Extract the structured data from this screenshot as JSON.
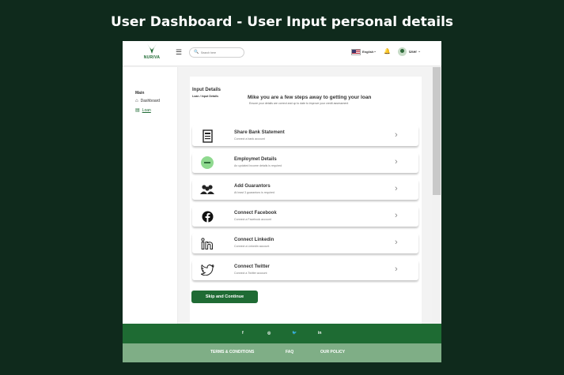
{
  "banner": {
    "title": "User Dashboard - User Input personal details"
  },
  "header": {
    "logo_text": "NURIVA",
    "search_placeholder": "Search here",
    "language": "English",
    "user_label": "User"
  },
  "sidebar": {
    "section": "Main",
    "items": [
      {
        "label": "Dashboard",
        "icon": "home-icon"
      },
      {
        "label": "Loan",
        "icon": "document-icon"
      }
    ]
  },
  "content": {
    "title": "Input Details",
    "breadcrumb": "Loan / Input Details",
    "headline": "Mike you are a few steps away to getting your loan",
    "subline": "Ensure your details are correct and up to date to improve your credit assessment",
    "rows": [
      {
        "title": "Share Bank Statement",
        "subtitle": "Connect a bank account",
        "icon": "bank-statement-icon"
      },
      {
        "title": "Employmet Details",
        "subtitle": "An updated income details is required",
        "icon": "employment-icon"
      },
      {
        "title": "Add Guarantors",
        "subtitle": "At least 3 guarantors is required",
        "icon": "guarantors-icon"
      },
      {
        "title": "Connect Facebook",
        "subtitle": "Connect a Facebook account",
        "icon": "facebook-icon"
      },
      {
        "title": "Connect Linkedin",
        "subtitle": "Connect a Linkedin account",
        "icon": "linkedin-icon"
      },
      {
        "title": "Connect Twitter",
        "subtitle": "Connect a Twitter account",
        "icon": "twitter-icon"
      }
    ],
    "skip_label": "Skip and Continue"
  },
  "footer": {
    "social": [
      "f",
      "◎",
      "🐦",
      "in"
    ],
    "links": [
      "TERMS & CONDITIONS",
      "FAQ",
      "OUR POLICY"
    ]
  },
  "colors": {
    "brand": "#1f6b34",
    "footer_light": "#7fae86",
    "background": "#0f2a1c"
  }
}
